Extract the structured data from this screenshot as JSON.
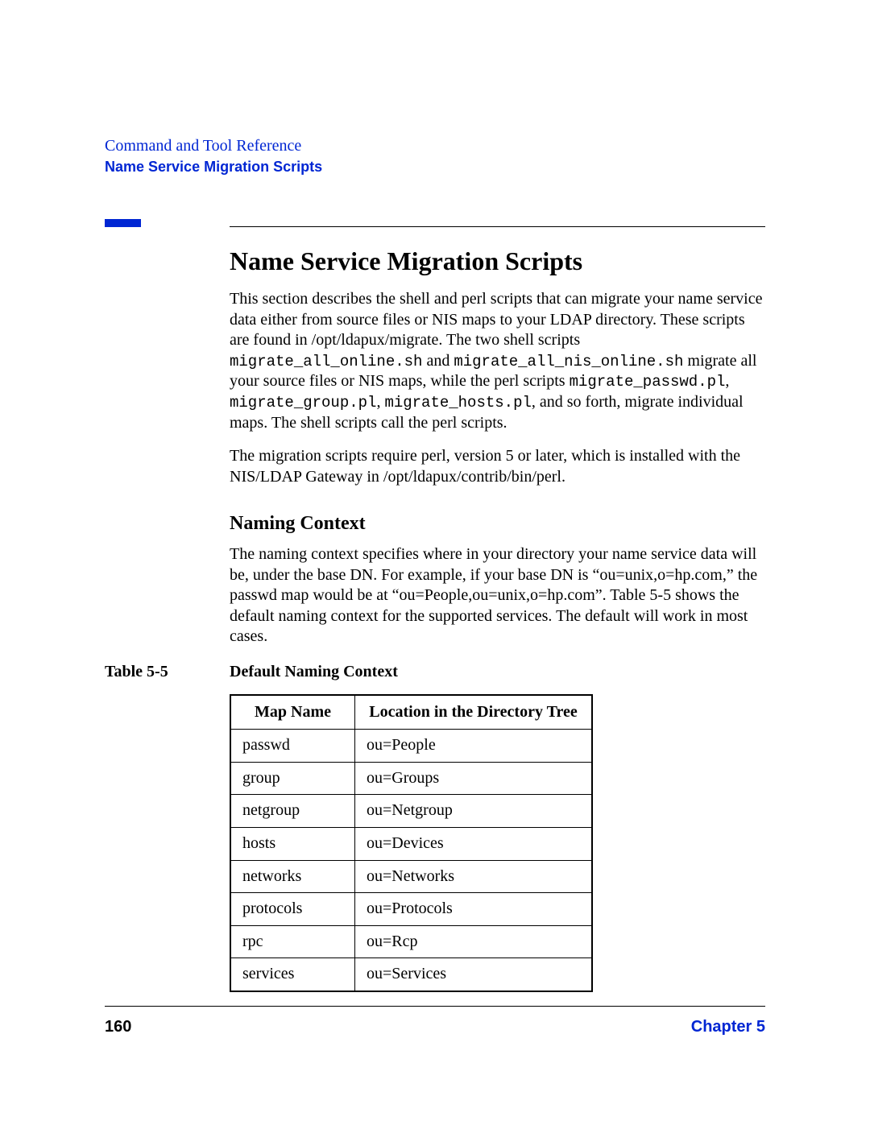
{
  "header": {
    "breadcrumb": "Command and Tool Reference",
    "section": "Name Service Migration Scripts"
  },
  "h1": "Name Service Migration Scripts",
  "p1_a": "This section describes the shell and perl scripts that can migrate your name service data either from source files or NIS maps to your LDAP directory. These scripts are found in /opt/ldapux/migrate. The two shell scripts ",
  "p1_code1": "migrate_all_online.sh",
  "p1_b": " and ",
  "p1_code2": "migrate_all_nis_online.sh",
  "p1_c": " migrate all your source files or NIS maps, while the perl scripts ",
  "p1_code3": "migrate_passwd.pl",
  "p1_d": ", ",
  "p1_code4": "migrate_group.pl",
  "p1_e": ", ",
  "p1_code5": "migrate_hosts.pl",
  "p1_f": ", and so forth, migrate individual maps. The shell scripts call the perl scripts.",
  "p2": "The migration scripts require perl, version 5 or later, which is installed with the NIS/LDAP Gateway in /opt/ldapux/contrib/bin/perl.",
  "h2": "Naming Context",
  "p3": "The naming context specifies where in your directory your name service data will be, under the base DN. For example, if your base DN is “ou=unix,o=hp.com,” the passwd map would be at “ou=People,ou=unix,o=hp.com”. Table 5-5 shows the default naming context for the supported services. The default will work in most cases.",
  "table": {
    "label": "Table 5-5",
    "title": "Default Naming Context",
    "col1": "Map Name",
    "col2": "Location in the Directory Tree",
    "rows": [
      {
        "map": "passwd",
        "loc": "ou=People"
      },
      {
        "map": "group",
        "loc": "ou=Groups"
      },
      {
        "map": "netgroup",
        "loc": "ou=Netgroup"
      },
      {
        "map": "hosts",
        "loc": "ou=Devices"
      },
      {
        "map": "networks",
        "loc": "ou=Networks"
      },
      {
        "map": "protocols",
        "loc": "ou=Protocols"
      },
      {
        "map": "rpc",
        "loc": "ou=Rcp"
      },
      {
        "map": "services",
        "loc": "ou=Services"
      }
    ]
  },
  "footer": {
    "page": "160",
    "chapter": "Chapter 5"
  }
}
